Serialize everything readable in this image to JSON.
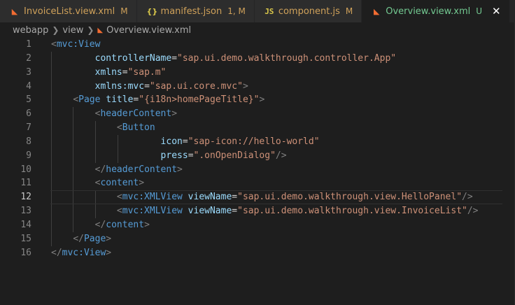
{
  "tabs": [
    {
      "icon": "rss-icon",
      "name": "InvoiceList.view.xml",
      "status": "M",
      "active": false
    },
    {
      "icon": "json-braces-icon",
      "name": "manifest.json",
      "status": "1, M",
      "active": false
    },
    {
      "icon": "js-file-icon",
      "name": "component.js",
      "status": "M",
      "active": false
    },
    {
      "icon": "rss-icon",
      "name": "Overview.view.xml",
      "status": "U",
      "active": true
    }
  ],
  "breadcrumb": [
    "webapp",
    "view",
    "Overview.view.xml"
  ],
  "editor": {
    "current_line": 12,
    "lines": [
      "<mvc:View",
      "controllerName=\"sap.ui.demo.walkthrough.controller.App\"",
      "xmlns=\"sap.m\"",
      "xmlns:mvc=\"sap.ui.core.mvc\">",
      "<Page title=\"{i18n>homePageTitle}\">",
      "<headerContent>",
      "<Button",
      "icon=\"sap-icon://hello-world\"",
      "press=\".onOpenDialog\"/>",
      "</headerContent>",
      "<content>",
      "<mvc:XMLView viewName=\"sap.ui.demo.walkthrough.view.HelloPanel\"/>",
      "<mvc:XMLView viewName=\"sap.ui.demo.walkthrough.view.InvoiceList\"/>",
      "</content>",
      "</Page>",
      "</mvc:View>"
    ]
  },
  "colors": {
    "tag": "#569cd6",
    "attribute": "#9cdcfe",
    "string": "#ce9178",
    "bracket": "#808080",
    "modified": "#cfa15a",
    "untracked": "#73c991"
  }
}
